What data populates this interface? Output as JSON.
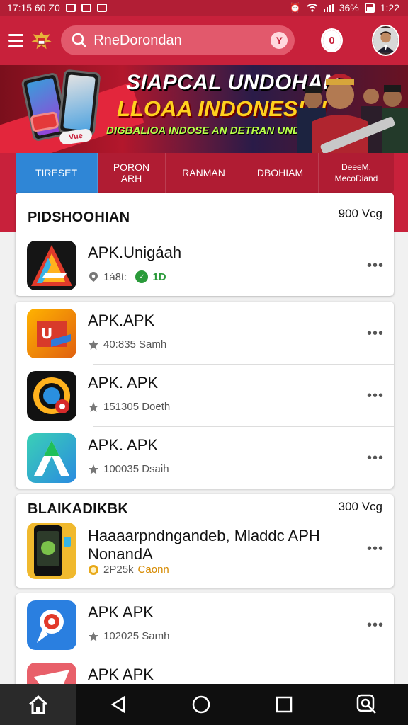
{
  "status_bar": {
    "time_left": "17:15 60 Z0",
    "battery": "36%",
    "time": "1:22"
  },
  "header": {
    "search_text": "RneDorondan",
    "scan_label": "Y",
    "notification_count": "0"
  },
  "banner": {
    "line1": "SIAPCAL UNDOHAN",
    "line2": "LLOAA INDONESIA!",
    "line3": "DIGBALIOA INDOSE AN DETRAN UNDOGOA",
    "chip": "Vue"
  },
  "tabs": [
    {
      "label": "TIRESET",
      "active": true
    },
    {
      "label": "PORON ARH",
      "active": false
    },
    {
      "label": "RANMAN",
      "active": false
    },
    {
      "label": "DBOHIAM",
      "active": false
    },
    {
      "label": "DeeeM. MecoDiand",
      "active": false
    }
  ],
  "section1": {
    "title": "PIDSHOOHIAN",
    "count": "900 Vcg",
    "featured": {
      "name": "APK.Unigáah",
      "meta": "1á8t:",
      "version": "1D"
    }
  },
  "list1": [
    {
      "name": "APK.APK",
      "meta": "40:835 Samh"
    },
    {
      "name": "APK. APK",
      "meta": "151305 Doeth"
    },
    {
      "name": "APK. APK",
      "meta": "100035 Dsaih"
    }
  ],
  "section2": {
    "title": "BLAIKADIKBK",
    "count": "300 Vcg",
    "item": {
      "name_line1": "Haaaarpndngandeb, Mladdc APH",
      "name_line2": "NonandA",
      "meta_value": "2P25k",
      "meta_word": "Caonn"
    }
  },
  "list2": [
    {
      "name": "APK APK",
      "meta": "102025 Samh"
    },
    {
      "name": "APK APK",
      "meta": ""
    }
  ],
  "more_label": "•••",
  "colors": {
    "primary": "#c8213b",
    "tab_active": "#2f86d6",
    "banner_yellow": "#ffd21e"
  }
}
